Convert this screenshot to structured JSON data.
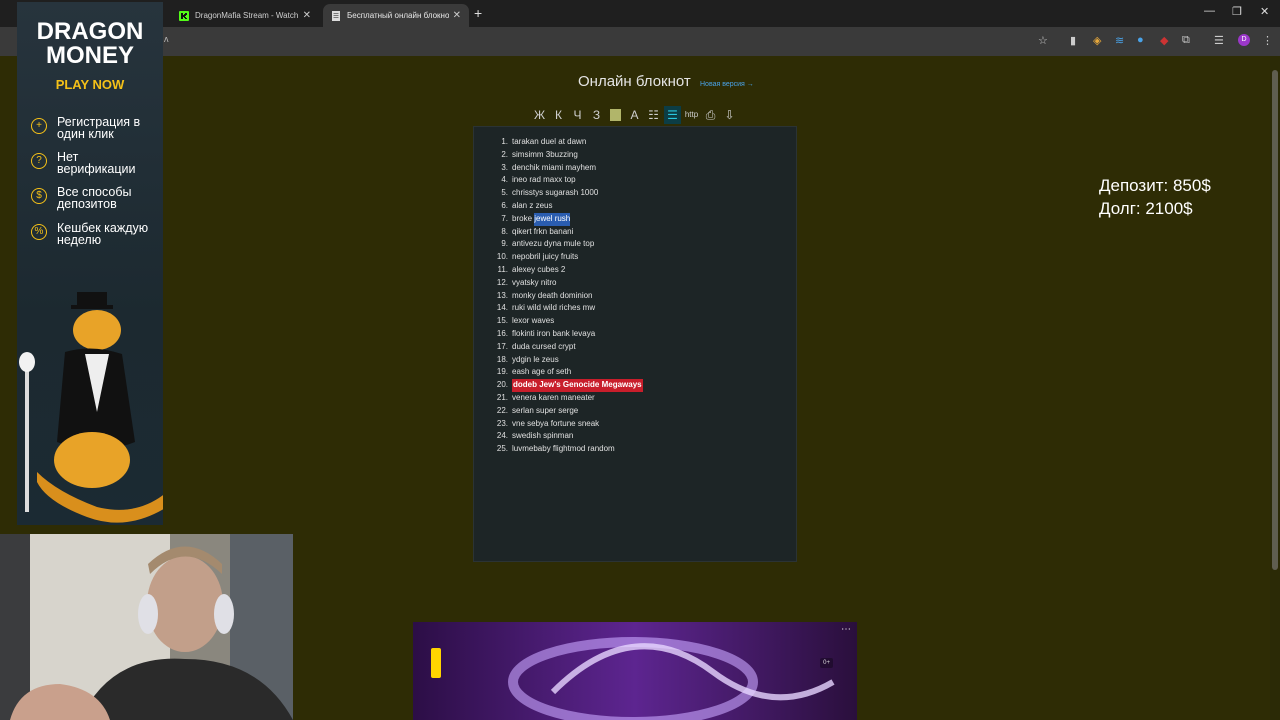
{
  "browser": {
    "tabs": [
      {
        "title": "DragonMafia Stream - Watch U"
      },
      {
        "title": "Бесплатный онлайн блокнот д"
      }
    ],
    "address": "ʌ"
  },
  "page": {
    "title": "Онлайн блокнот",
    "new_version": "Новая версия →",
    "toolbar": [
      "Ж",
      "К",
      "Ч",
      "З",
      "",
      "А",
      "",
      "",
      "http",
      "",
      "⇩"
    ]
  },
  "notepad": {
    "items": [
      {
        "num": "1.",
        "text": "tarakan duel at dawn"
      },
      {
        "num": "2.",
        "text": "simsimm 3buzzing"
      },
      {
        "num": "3.",
        "text": "denchik miami mayhem"
      },
      {
        "num": "4.",
        "text": "ineo rad maxx top"
      },
      {
        "num": "5.",
        "text": "chrisstys sugarash 1000"
      },
      {
        "num": "6.",
        "text": "alan z zeus"
      },
      {
        "num": "7.",
        "text_before": "broke ",
        "text_highlight": "jewel rush"
      },
      {
        "num": "8.",
        "text": "qikert frkn banani"
      },
      {
        "num": "9.",
        "text": "antivezu dyna mule top"
      },
      {
        "num": "10.",
        "text": "nepobril juicy fruits"
      },
      {
        "num": "11.",
        "text": "alexey cubes 2"
      },
      {
        "num": "12.",
        "text": "vyatsky nitro"
      },
      {
        "num": "13.",
        "text": "monky death dominion"
      },
      {
        "num": "14.",
        "text": "ruki wild wild riches mw"
      },
      {
        "num": "15.",
        "text": "lexor waves"
      },
      {
        "num": "16.",
        "text": "flokinti iron bank levaya"
      },
      {
        "num": "17.",
        "text": "duda cursed crypt"
      },
      {
        "num": "18.",
        "text": "ydgin le zeus"
      },
      {
        "num": "19.",
        "text": "eash age of seth"
      },
      {
        "num": "20.",
        "text_red": "dodeb Jew's Genocide Megaways"
      },
      {
        "num": "21.",
        "text": "venera karen maneater"
      },
      {
        "num": "22.",
        "text": "serlan super serge"
      },
      {
        "num": "23.",
        "text": "vne sebya fortune sneak"
      },
      {
        "num": "24.",
        "text": "swedish spinman"
      },
      {
        "num": "25.",
        "text": "luvmebaby flightmod random"
      }
    ]
  },
  "overlay": {
    "deposit": "Депозит: 850$",
    "debt": "Долг: 2100$"
  },
  "ad": {
    "brand_line1": "DRAGON",
    "brand_line2": "MONEY",
    "cta": "PLAY NOW",
    "features": [
      {
        "icon": "plus-circle-icon",
        "text": "Регистрация в один клик"
      },
      {
        "icon": "question-circle-icon",
        "text": "Нет верификации"
      },
      {
        "icon": "coin-icon",
        "text": "Все способы депозитов"
      },
      {
        "icon": "percent-icon",
        "text": "Кешбек каждую неделю"
      }
    ]
  },
  "video": {
    "badge": "0+"
  },
  "colors": {
    "page_bg": "#2e2c05",
    "accent": "#f5c118",
    "highlight": "#2a5db0",
    "red_mark": "#c81e2b"
  }
}
